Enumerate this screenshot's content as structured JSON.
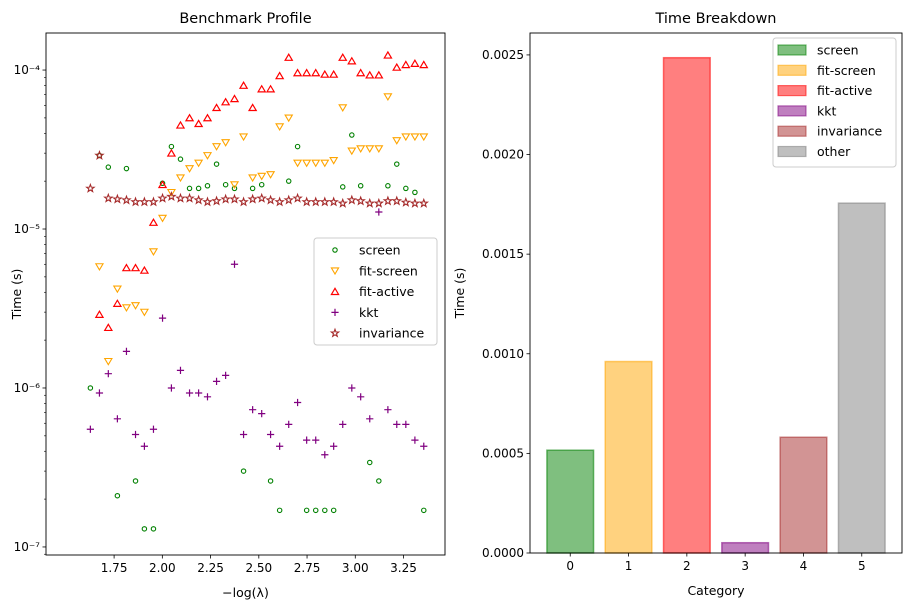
{
  "chart_data": [
    {
      "type": "scatter",
      "title": "Benchmark Profile",
      "xlabel": "−log(λ)",
      "ylabel": "Time (s)",
      "yscale": "log",
      "xlim": [
        1.397,
        3.465
      ],
      "ylim": [
        8.9e-08,
        0.000171
      ],
      "xticks": [
        1.75,
        2.0,
        2.25,
        2.5,
        2.75,
        3.0,
        3.25
      ],
      "xtick_labels": [
        "1.75",
        "2.00",
        "2.25",
        "2.50",
        "2.75",
        "3.00",
        "3.25"
      ],
      "yticks": [
        0.0001,
        1e-05,
        1e-06,
        1e-07
      ],
      "ytick_labels": [
        "10⁻⁴",
        "10⁻⁵",
        "10⁻⁶",
        "10⁻⁷"
      ],
      "grid": false,
      "legend_position": "center-right",
      "x": [
        1.627,
        1.674,
        1.72,
        1.767,
        1.814,
        1.861,
        1.907,
        1.954,
        2.001,
        2.047,
        2.094,
        2.141,
        2.188,
        2.234,
        2.281,
        2.328,
        2.374,
        2.421,
        2.468,
        2.515,
        2.561,
        2.608,
        2.655,
        2.701,
        2.748,
        2.795,
        2.842,
        2.888,
        2.935,
        2.982,
        3.028,
        3.075,
        3.122,
        3.169,
        3.215,
        3.262,
        3.309,
        3.355
      ],
      "series": [
        {
          "name": "screen",
          "marker": "circle-open",
          "color": "#008000",
          "values": [
            1e-06,
            2.9e-05,
            2.45e-05,
            2.1e-07,
            2.4e-05,
            2.6e-07,
            1.3e-07,
            1.3e-07,
            1.94e-05,
            3.3e-05,
            2.75e-05,
            1.8e-05,
            1.8e-05,
            1.87e-05,
            2.56e-05,
            1.9e-05,
            1.8e-05,
            3e-07,
            1.8e-05,
            1.9e-05,
            2.6e-07,
            1.7e-07,
            2e-05,
            3.3e-05,
            1.7e-07,
            1.7e-07,
            1.7e-07,
            1.7e-07,
            1.84e-05,
            3.9e-05,
            1.87e-05,
            3.4e-07,
            2.6e-07,
            1.87e-05,
            2.56e-05,
            1.8e-05,
            1.7e-05,
            1.7e-07
          ]
        },
        {
          "name": "fit-screen",
          "marker": "triangle-down-open",
          "color": "#ffa500",
          "values": [
            null,
            5.8e-06,
            1.47e-06,
            4.2e-06,
            3.2e-06,
            3.3e-06,
            3e-06,
            7.2e-06,
            1.17e-05,
            1.7e-05,
            2.1e-05,
            2.4e-05,
            2.6e-05,
            2.9e-05,
            3.3e-05,
            3.5e-05,
            1.9e-05,
            3.8e-05,
            2.1e-05,
            2.15e-05,
            2.2e-05,
            4.4e-05,
            5e-05,
            2.6e-05,
            2.6e-05,
            2.6e-05,
            2.6e-05,
            2.7e-05,
            5.8e-05,
            3.1e-05,
            3.2e-05,
            3.2e-05,
            3.2e-05,
            6.8e-05,
            3.6e-05,
            3.8e-05,
            3.8e-05,
            3.8e-05
          ]
        },
        {
          "name": "fit-active",
          "marker": "triangle-up-open",
          "color": "#ff0000",
          "values": [
            null,
            2.9e-06,
            2.4e-06,
            3.4e-06,
            5.7e-06,
            5.7e-06,
            5.5e-06,
            1.1e-05,
            1.9e-05,
            3e-05,
            4.5e-05,
            5e-05,
            4.6e-05,
            5e-05,
            5.8e-05,
            6.3e-05,
            6.6e-05,
            8e-05,
            5.8e-05,
            7.6e-05,
            7.6e-05,
            9.2e-05,
            0.00012,
            9.6e-05,
            9.6e-05,
            9.6e-05,
            9.4e-05,
            9.4e-05,
            0.00012,
            0.000114,
            9.6e-05,
            9.3e-05,
            9.3e-05,
            0.000124,
            0.000104,
            0.000108,
            0.00011,
            0.000108
          ]
        },
        {
          "name": "kkt",
          "marker": "plus",
          "color": "#800080",
          "values": [
            5.5e-07,
            9.3e-07,
            1.23e-06,
            6.4e-07,
            1.7e-06,
            5.1e-07,
            4.3e-07,
            5.5e-07,
            2.75e-06,
            1e-06,
            1.29e-06,
            9.3e-07,
            9.3e-07,
            8.8e-07,
            1.1e-06,
            1.2e-06,
            6e-06,
            5.1e-07,
            7.3e-07,
            6.9e-07,
            5.1e-07,
            4.3e-07,
            5.9e-07,
            8.1e-07,
            4.7e-07,
            4.7e-07,
            3.8e-07,
            4.3e-07,
            5.9e-07,
            1e-06,
            8.8e-07,
            6.4e-07,
            1.28e-05,
            7.3e-07,
            5.9e-07,
            5.9e-07,
            4.7e-07,
            4.3e-07
          ]
        },
        {
          "name": "invariance",
          "marker": "star-open",
          "color": "#a52a2a",
          "values": [
            1.8e-05,
            2.9e-05,
            1.56e-05,
            1.54e-05,
            1.52e-05,
            1.48e-05,
            1.48e-05,
            1.48e-05,
            1.56e-05,
            1.6e-05,
            1.56e-05,
            1.56e-05,
            1.52e-05,
            1.48e-05,
            1.5e-05,
            1.54e-05,
            1.54e-05,
            1.48e-05,
            1.54e-05,
            1.56e-05,
            1.52e-05,
            1.48e-05,
            1.52e-05,
            1.56e-05,
            1.48e-05,
            1.48e-05,
            1.48e-05,
            1.48e-05,
            1.45e-05,
            1.52e-05,
            1.5e-05,
            1.45e-05,
            1.45e-05,
            1.5e-05,
            1.5e-05,
            1.47e-05,
            1.45e-05,
            1.45e-05
          ]
        }
      ]
    },
    {
      "type": "bar",
      "title": "Time Breakdown",
      "xlabel": "Category",
      "ylabel": "Time (s)",
      "categories": [
        "0",
        "1",
        "2",
        "3",
        "4",
        "5"
      ],
      "ylim": [
        0,
        0.00261
      ],
      "yticks": [
        0,
        0.0005,
        0.001,
        0.0015,
        0.002,
        0.0025
      ],
      "ytick_labels": [
        "0.0000",
        "0.0005",
        "0.0010",
        "0.0015",
        "0.0020",
        "0.0025"
      ],
      "grid": false,
      "legend_position": "top-right",
      "series": [
        {
          "name": "screen",
          "value": 0.000516,
          "color": "#008000"
        },
        {
          "name": "fit-screen",
          "value": 0.000961,
          "color": "#ffa500"
        },
        {
          "name": "fit-active",
          "value": 0.002486,
          "color": "#ff0000"
        },
        {
          "name": "kkt",
          "value": 5.16e-05,
          "color": "#800080"
        },
        {
          "name": "invariance",
          "value": 0.000581,
          "color": "#a52a2a"
        },
        {
          "name": "other",
          "value": 0.001756,
          "color": "#808080"
        }
      ]
    }
  ]
}
